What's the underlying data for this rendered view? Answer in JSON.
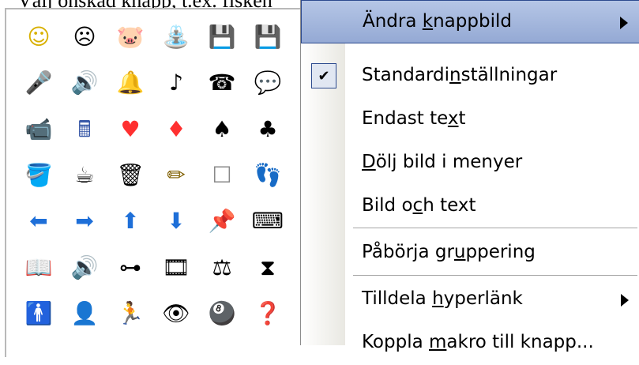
{
  "caption": "Välj önskad knapp, t.ex. fisken",
  "icons": [
    [
      "☺",
      "☹",
      "🐷",
      "⛲",
      "💾",
      "💾"
    ],
    [
      "🎤",
      "🔊",
      "🔔",
      "♪",
      "☎",
      "💬"
    ],
    [
      "📹",
      "🖩",
      "♥",
      "♦",
      "♠",
      "♣"
    ],
    [
      "🪣",
      "☕",
      "🗑",
      "✏",
      "☐",
      "👣"
    ],
    [
      "⬅",
      "➡",
      "⬆",
      "⬇",
      "📌",
      "⌨"
    ],
    [
      "📖",
      "🔊",
      "⊶",
      "🎞",
      "⚖",
      "⧗"
    ],
    [
      "🚹",
      "👤",
      "🏃",
      "👁",
      "🎱",
      "❓"
    ]
  ],
  "icon_colors": [
    [
      "#d8b000",
      "#000000",
      "#555555",
      "#000000",
      "#1a1a7a",
      "#1a1a7a"
    ],
    [
      "#404080",
      "#000000",
      "#c09000",
      "#000000",
      "#000000",
      "#000000"
    ],
    [
      "#000000",
      "#3a5aa8",
      "#ff3030",
      "#ff3030",
      "#000000",
      "#000000"
    ],
    [
      "#102080",
      "#000000",
      "#000000",
      "#806000",
      "#888888",
      "#666666"
    ],
    [
      "#1e6fd8",
      "#1e6fd8",
      "#1e6fd8",
      "#1e6fd8",
      "#666666",
      "#000000"
    ],
    [
      "#000000",
      "#000000",
      "#000000",
      "#000000",
      "#000000",
      "#000000"
    ],
    [
      "#000000",
      "#000000",
      "#000000",
      "#000000",
      "#000000",
      "#c0a000"
    ]
  ],
  "menu": {
    "items": [
      {
        "pre": "Ändra ",
        "u": "k",
        "post": "nappbild",
        "submenu": true,
        "highlight": true
      },
      {
        "pre": "Standardi",
        "u": "n",
        "post": "ställningar",
        "checked": true
      },
      {
        "pre": "Endast te",
        "u": "x",
        "post": "t"
      },
      {
        "pre": "",
        "u": "D",
        "post": "ölj bild i menyer"
      },
      {
        "pre": "Bild o",
        "u": "c",
        "post": "h text"
      },
      {
        "pre": "Påbörja gr",
        "u": "u",
        "post": "ppering"
      },
      {
        "pre": "Tilldela ",
        "u": "h",
        "post": "yperlänk",
        "submenu": true
      },
      {
        "pre": "Koppla ",
        "u": "m",
        "post": "akro till knapp..."
      }
    ]
  }
}
